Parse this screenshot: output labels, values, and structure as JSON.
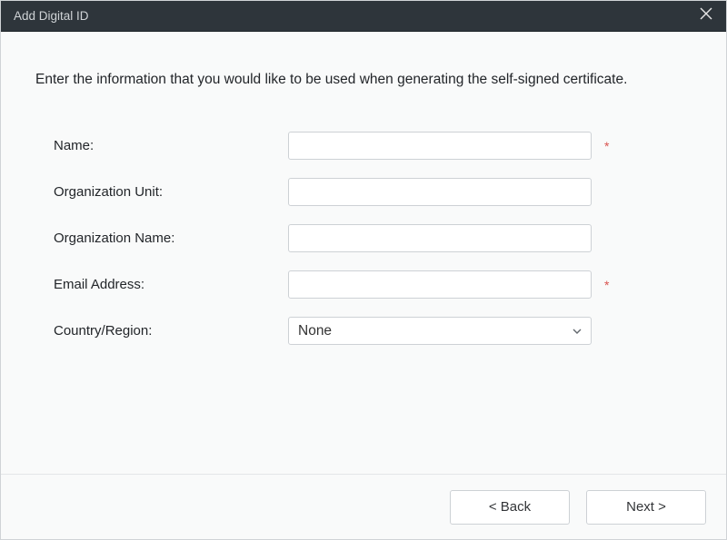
{
  "titlebar": {
    "title": "Add Digital ID"
  },
  "content": {
    "instruction": "Enter the information that you would like to be used when generating the self-signed certificate."
  },
  "form": {
    "name": {
      "label": "Name:",
      "value": "",
      "required_mark": "*"
    },
    "org_unit": {
      "label": "Organization Unit:",
      "value": ""
    },
    "org_name": {
      "label": "Organization Name:",
      "value": ""
    },
    "email": {
      "label": "Email Address:",
      "value": "",
      "required_mark": "*"
    },
    "country": {
      "label": "Country/Region:",
      "selected": "None"
    }
  },
  "footer": {
    "back_label": "< Back",
    "next_label": "Next >"
  }
}
